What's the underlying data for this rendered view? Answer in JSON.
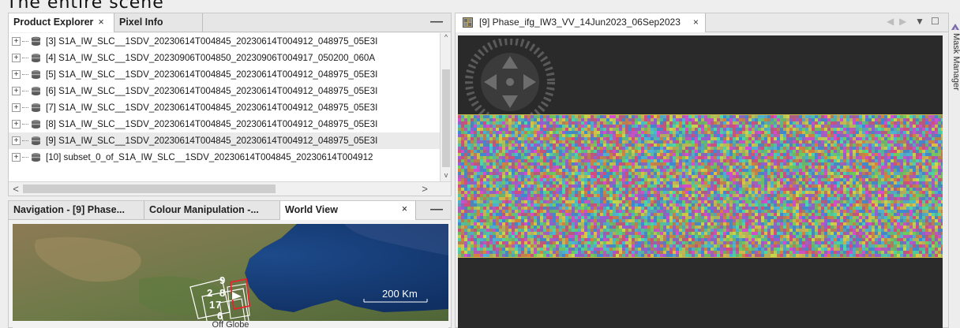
{
  "top_text": "The entire scene",
  "product_explorer": {
    "tabs": [
      {
        "label": "Product Explorer",
        "close": "×"
      },
      {
        "label": "Pixel Info"
      }
    ],
    "minimize": "—",
    "items": [
      {
        "label": "[3] S1A_IW_SLC__1SDV_20230614T004845_20230614T004912_048975_05E3I"
      },
      {
        "label": "[4] S1A_IW_SLC__1SDV_20230906T004850_20230906T004917_050200_060A"
      },
      {
        "label": "[5] S1A_IW_SLC__1SDV_20230614T004845_20230614T004912_048975_05E3I"
      },
      {
        "label": "[6] S1A_IW_SLC__1SDV_20230614T004845_20230614T004912_048975_05E3I"
      },
      {
        "label": "[7] S1A_IW_SLC__1SDV_20230614T004845_20230614T004912_048975_05E3I"
      },
      {
        "label": "[8] S1A_IW_SLC__1SDV_20230614T004845_20230614T004912_048975_05E3I"
      },
      {
        "label": "[9] S1A_IW_SLC__1SDV_20230614T004845_20230614T004912_048975_05E3I"
      },
      {
        "label": "[10] subset_0_of_S1A_IW_SLC__1SDV_20230614T004845_20230614T004912"
      }
    ],
    "expander": "+",
    "scroll_up": "^",
    "scroll_down": "v",
    "scroll_left": "<",
    "scroll_right": ">"
  },
  "nav_panel": {
    "tabs": [
      {
        "label": "Navigation - [9] Phase..."
      },
      {
        "label": "Colour Manipulation -..."
      },
      {
        "label": "World View"
      }
    ],
    "close": "×",
    "minimize": "—",
    "footprint_labels": [
      "9",
      "2",
      "8",
      "1",
      "7",
      "6",
      "5"
    ],
    "scale_label": "200 Km",
    "off_globe": "Off Globe"
  },
  "image_view": {
    "tab_label": "[9] Phase_ifg_IW3_VV_14Jun2023_06Sep2023",
    "close": "×",
    "controls": {
      "prev": "◀",
      "next": "▶",
      "menu": "▼",
      "maximize": "☐"
    }
  },
  "side_panel": {
    "label": "Mask Manager"
  },
  "colors": {
    "accent_red": "#e0262e",
    "footprint_white": "#ffffff",
    "interferogram_border": "#c9b94a",
    "image_background": "#2a2a2a"
  }
}
